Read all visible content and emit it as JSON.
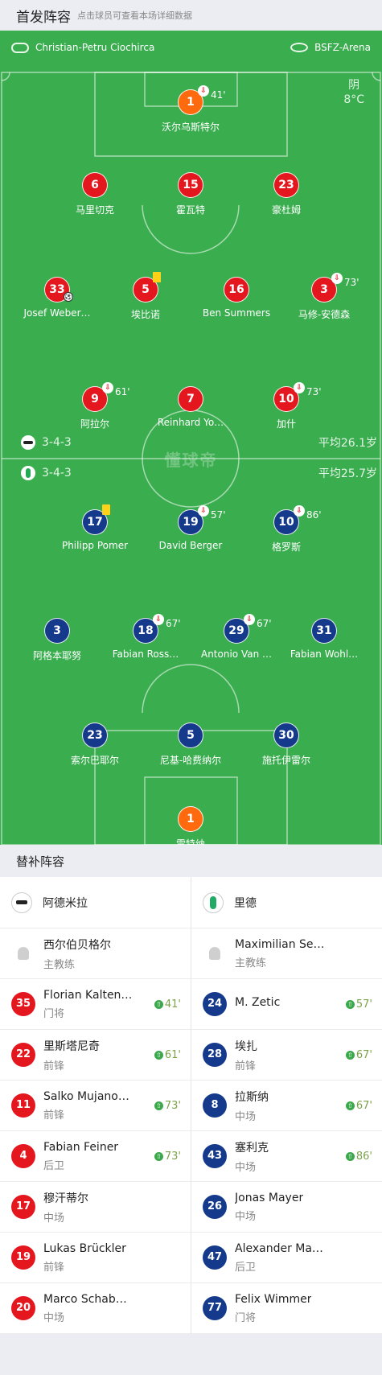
{
  "header": {
    "title": "首发阵容",
    "hint": "点击球员可查看本场详细数据"
  },
  "match": {
    "referee": "Christian-Petru Ciochirca",
    "venue": "BSFZ-Arena",
    "weather": "阴",
    "temperature": "8°C",
    "watermark": "懂球帝"
  },
  "home_team": {
    "formation": "3-4-3",
    "avg_age": "平均26.1岁"
  },
  "away_team": {
    "formation": "3-4-3",
    "avg_age": "平均25.7岁"
  },
  "home_players": [
    {
      "num": "1",
      "name": "沃尔乌斯特尔",
      "sub": "41'",
      "gk": true
    },
    {
      "num": "6",
      "name": "马里切克"
    },
    {
      "num": "15",
      "name": "霍瓦特"
    },
    {
      "num": "23",
      "name": "豪杜姆"
    },
    {
      "num": "33",
      "name": "Josef Weber…",
      "goal": true
    },
    {
      "num": "5",
      "name": "埃比诺",
      "yellow": true
    },
    {
      "num": "16",
      "name": "Ben Summers"
    },
    {
      "num": "3",
      "name": "马修-安德森",
      "sub": "73'"
    },
    {
      "num": "9",
      "name": "阿拉尔",
      "sub": "61'"
    },
    {
      "num": "7",
      "name": "Reinhard Yo…"
    },
    {
      "num": "10",
      "name": "加什",
      "sub": "73'"
    }
  ],
  "away_players": [
    {
      "num": "17",
      "name": "Philipp Pomer",
      "yellow": true
    },
    {
      "num": "19",
      "name": "David Berger",
      "sub": "57'"
    },
    {
      "num": "10",
      "name": "格罗斯",
      "sub": "86'"
    },
    {
      "num": "3",
      "name": "阿格本耶努"
    },
    {
      "num": "18",
      "name": "Fabian Ross…",
      "sub": "67'"
    },
    {
      "num": "29",
      "name": "Antonio Van …",
      "sub": "67'"
    },
    {
      "num": "31",
      "name": "Fabian Wohl…"
    },
    {
      "num": "23",
      "name": "索尔巴耶尔"
    },
    {
      "num": "5",
      "name": "尼基-哈费纳尔"
    },
    {
      "num": "30",
      "name": "施托伊雷尔"
    },
    {
      "num": "1",
      "name": "雷特纳",
      "gk": true
    }
  ],
  "subs_title": "替补阵容",
  "subs_home": {
    "team": "阿德米拉",
    "coach": {
      "name": "西尔伯贝格尔",
      "role": "主教练"
    },
    "players": [
      {
        "num": "35",
        "name": "Florian Kalten…",
        "pos": "门将",
        "in": "41'"
      },
      {
        "num": "22",
        "name": "里斯塔尼奇",
        "pos": "前锋",
        "in": "61'"
      },
      {
        "num": "11",
        "name": "Salko Mujano…",
        "pos": "前锋",
        "in": "73'"
      },
      {
        "num": "4",
        "name": "Fabian Feiner",
        "pos": "后卫",
        "in": "73'"
      },
      {
        "num": "17",
        "name": "穆汗蒂尔",
        "pos": "中场"
      },
      {
        "num": "19",
        "name": "Lukas Brückler",
        "pos": "前锋"
      },
      {
        "num": "20",
        "name": "Marco Schab…",
        "pos": "中场"
      }
    ]
  },
  "subs_away": {
    "team": "里德",
    "coach": {
      "name": "Maximilian Senft",
      "role": "主教练"
    },
    "players": [
      {
        "num": "24",
        "name": "M. Zetic",
        "pos": "",
        "in": "57'"
      },
      {
        "num": "28",
        "name": "埃扎",
        "pos": "前锋",
        "in": "67'"
      },
      {
        "num": "8",
        "name": "拉斯纳",
        "pos": "中场",
        "in": "67'"
      },
      {
        "num": "43",
        "name": "塞利克",
        "pos": "中场",
        "in": "86'"
      },
      {
        "num": "26",
        "name": "Jonas Mayer",
        "pos": "中场"
      },
      {
        "num": "47",
        "name": "Alexander Ma…",
        "pos": "后卫"
      },
      {
        "num": "77",
        "name": "Felix Wimmer",
        "pos": "门将"
      }
    ]
  }
}
